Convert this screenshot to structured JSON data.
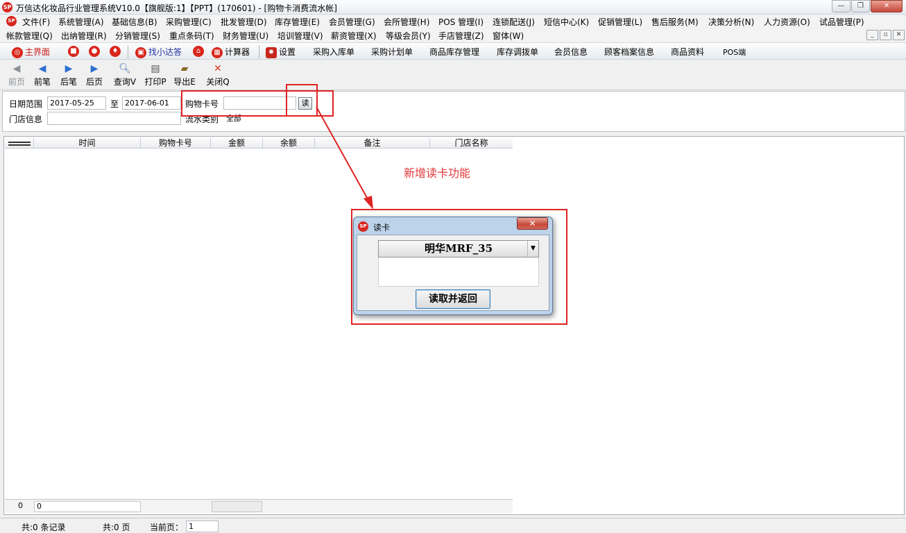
{
  "window": {
    "title": "万信达化妆品行业管理系统V10.0【旗舰版:1】【PPT】(170601) - [购物卡消费流水帐]",
    "minimize": "—",
    "maximize": "❐",
    "close": "✕"
  },
  "menu_row1": [
    "文件(F)",
    "系统管理(A)",
    "基础信息(B)",
    "采购管理(C)",
    "批发管理(D)",
    "库存管理(E)",
    "会员管理(G)",
    "会所管理(H)",
    "POS 管理(I)",
    "连锁配送(J)",
    "短信中心(K)",
    "促销管理(L)",
    "售后服务(M)",
    "决策分析(N)",
    "人力资源(O)",
    "试品管理(P)"
  ],
  "menu_row2": [
    "帐款管理(Q)",
    "出纳管理(R)",
    "分销管理(S)",
    "重点条码(T)",
    "财务管理(U)",
    "培训管理(V)",
    "薪资管理(X)",
    "等级会员(Y)",
    "手店管理(Z)",
    "窗体(W)"
  ],
  "mdi": {
    "min": "_",
    "restore": "▫",
    "close": "✕"
  },
  "toolbar": {
    "main": "主界面",
    "finder": "找小达答",
    "calculator": "计算器",
    "settings": "设置",
    "links": [
      "采购入库单",
      "采购计划单",
      "商品库存管理",
      "库存调拨单",
      "会员信息",
      "顾客档案信息",
      "商品资料",
      "POS端"
    ]
  },
  "nav": {
    "first": "前页",
    "prev": "前笔",
    "next": "后笔",
    "last": "后页",
    "query": "查询V",
    "print": "打印P",
    "export": "导出E",
    "close": "关闭Q"
  },
  "filter": {
    "date_label": "日期范围",
    "date_from": "2017-05-25",
    "to_label": "至",
    "date_to": "2017-06-01",
    "card_label": "购物卡号",
    "card_value": "",
    "read_btn": "读",
    "store_label": "门店信息",
    "store_value": "",
    "type_label": "流水类别",
    "type_value": "全部"
  },
  "grid": {
    "columns": [
      "时间",
      "购物卡号",
      "金额",
      "余额",
      "备注",
      "门店名称"
    ],
    "footer": {
      "count": "0",
      "sum": "0"
    }
  },
  "annotation": "新增读卡功能",
  "dialog": {
    "title": "读卡",
    "close": "✕",
    "reader": "明华MRF_35",
    "dropdown_arrow": "▼",
    "button": "读取并返回"
  },
  "status": {
    "records": "共:0 条记录",
    "pages": "共:0 页",
    "current_label": "当前页：",
    "current_value": "1"
  },
  "colors": {
    "annotation_red": "#e02222",
    "brand_red": "#d7261f"
  }
}
